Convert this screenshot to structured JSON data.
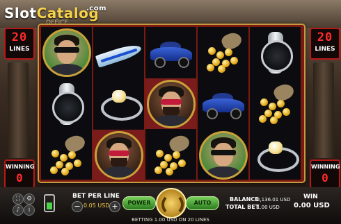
{
  "logo": {
    "part1": "Slot",
    "part2": "Catalog",
    "suffix": ".com",
    "ghost_text": "OFFICE"
  },
  "left_panel": {
    "lines_value": "20",
    "lines_label": "LINES",
    "winning_label": "WINNING",
    "winning_value": "0"
  },
  "right_panel": {
    "lines_value": "20",
    "lines_label": "LINES",
    "winning_label": "WINNING",
    "winning_value": "0"
  },
  "reels": [
    [
      "masked-man-portrait",
      "luxury-watch",
      "gold-coins-bag"
    ],
    [
      "speedboat",
      "diamond-ring",
      "bearded-man-portrait"
    ],
    [
      "sports-car",
      "bearded-man-portrait",
      "gold-coins-bag"
    ],
    [
      "gold-coins-bag",
      "sports-car",
      "masked-man-portrait"
    ],
    [
      "luxury-watch",
      "gold-coins-bag",
      "diamond-ring"
    ]
  ],
  "controls": {
    "bet_per_line_label": "BET PER LINE",
    "bet_per_line_value": "0.05 USD",
    "power_label": "POWER",
    "auto_label": "AUTO",
    "balance_label": "BALANCE",
    "balance_value": "4,136.01 USD",
    "total_bet_label": "TOTAL BET",
    "total_bet_value": "1.00 USD",
    "win_label": "WIN",
    "win_value": "0.00 USD",
    "minus": "−",
    "plus": "+"
  },
  "status": {
    "betting_text": "BETTING 1.00 USD ON 20 LINES"
  },
  "colors": {
    "accent_gold": "#f2c94c",
    "lines_red": "#ff2b2b",
    "button_green": "#7ad05a"
  }
}
